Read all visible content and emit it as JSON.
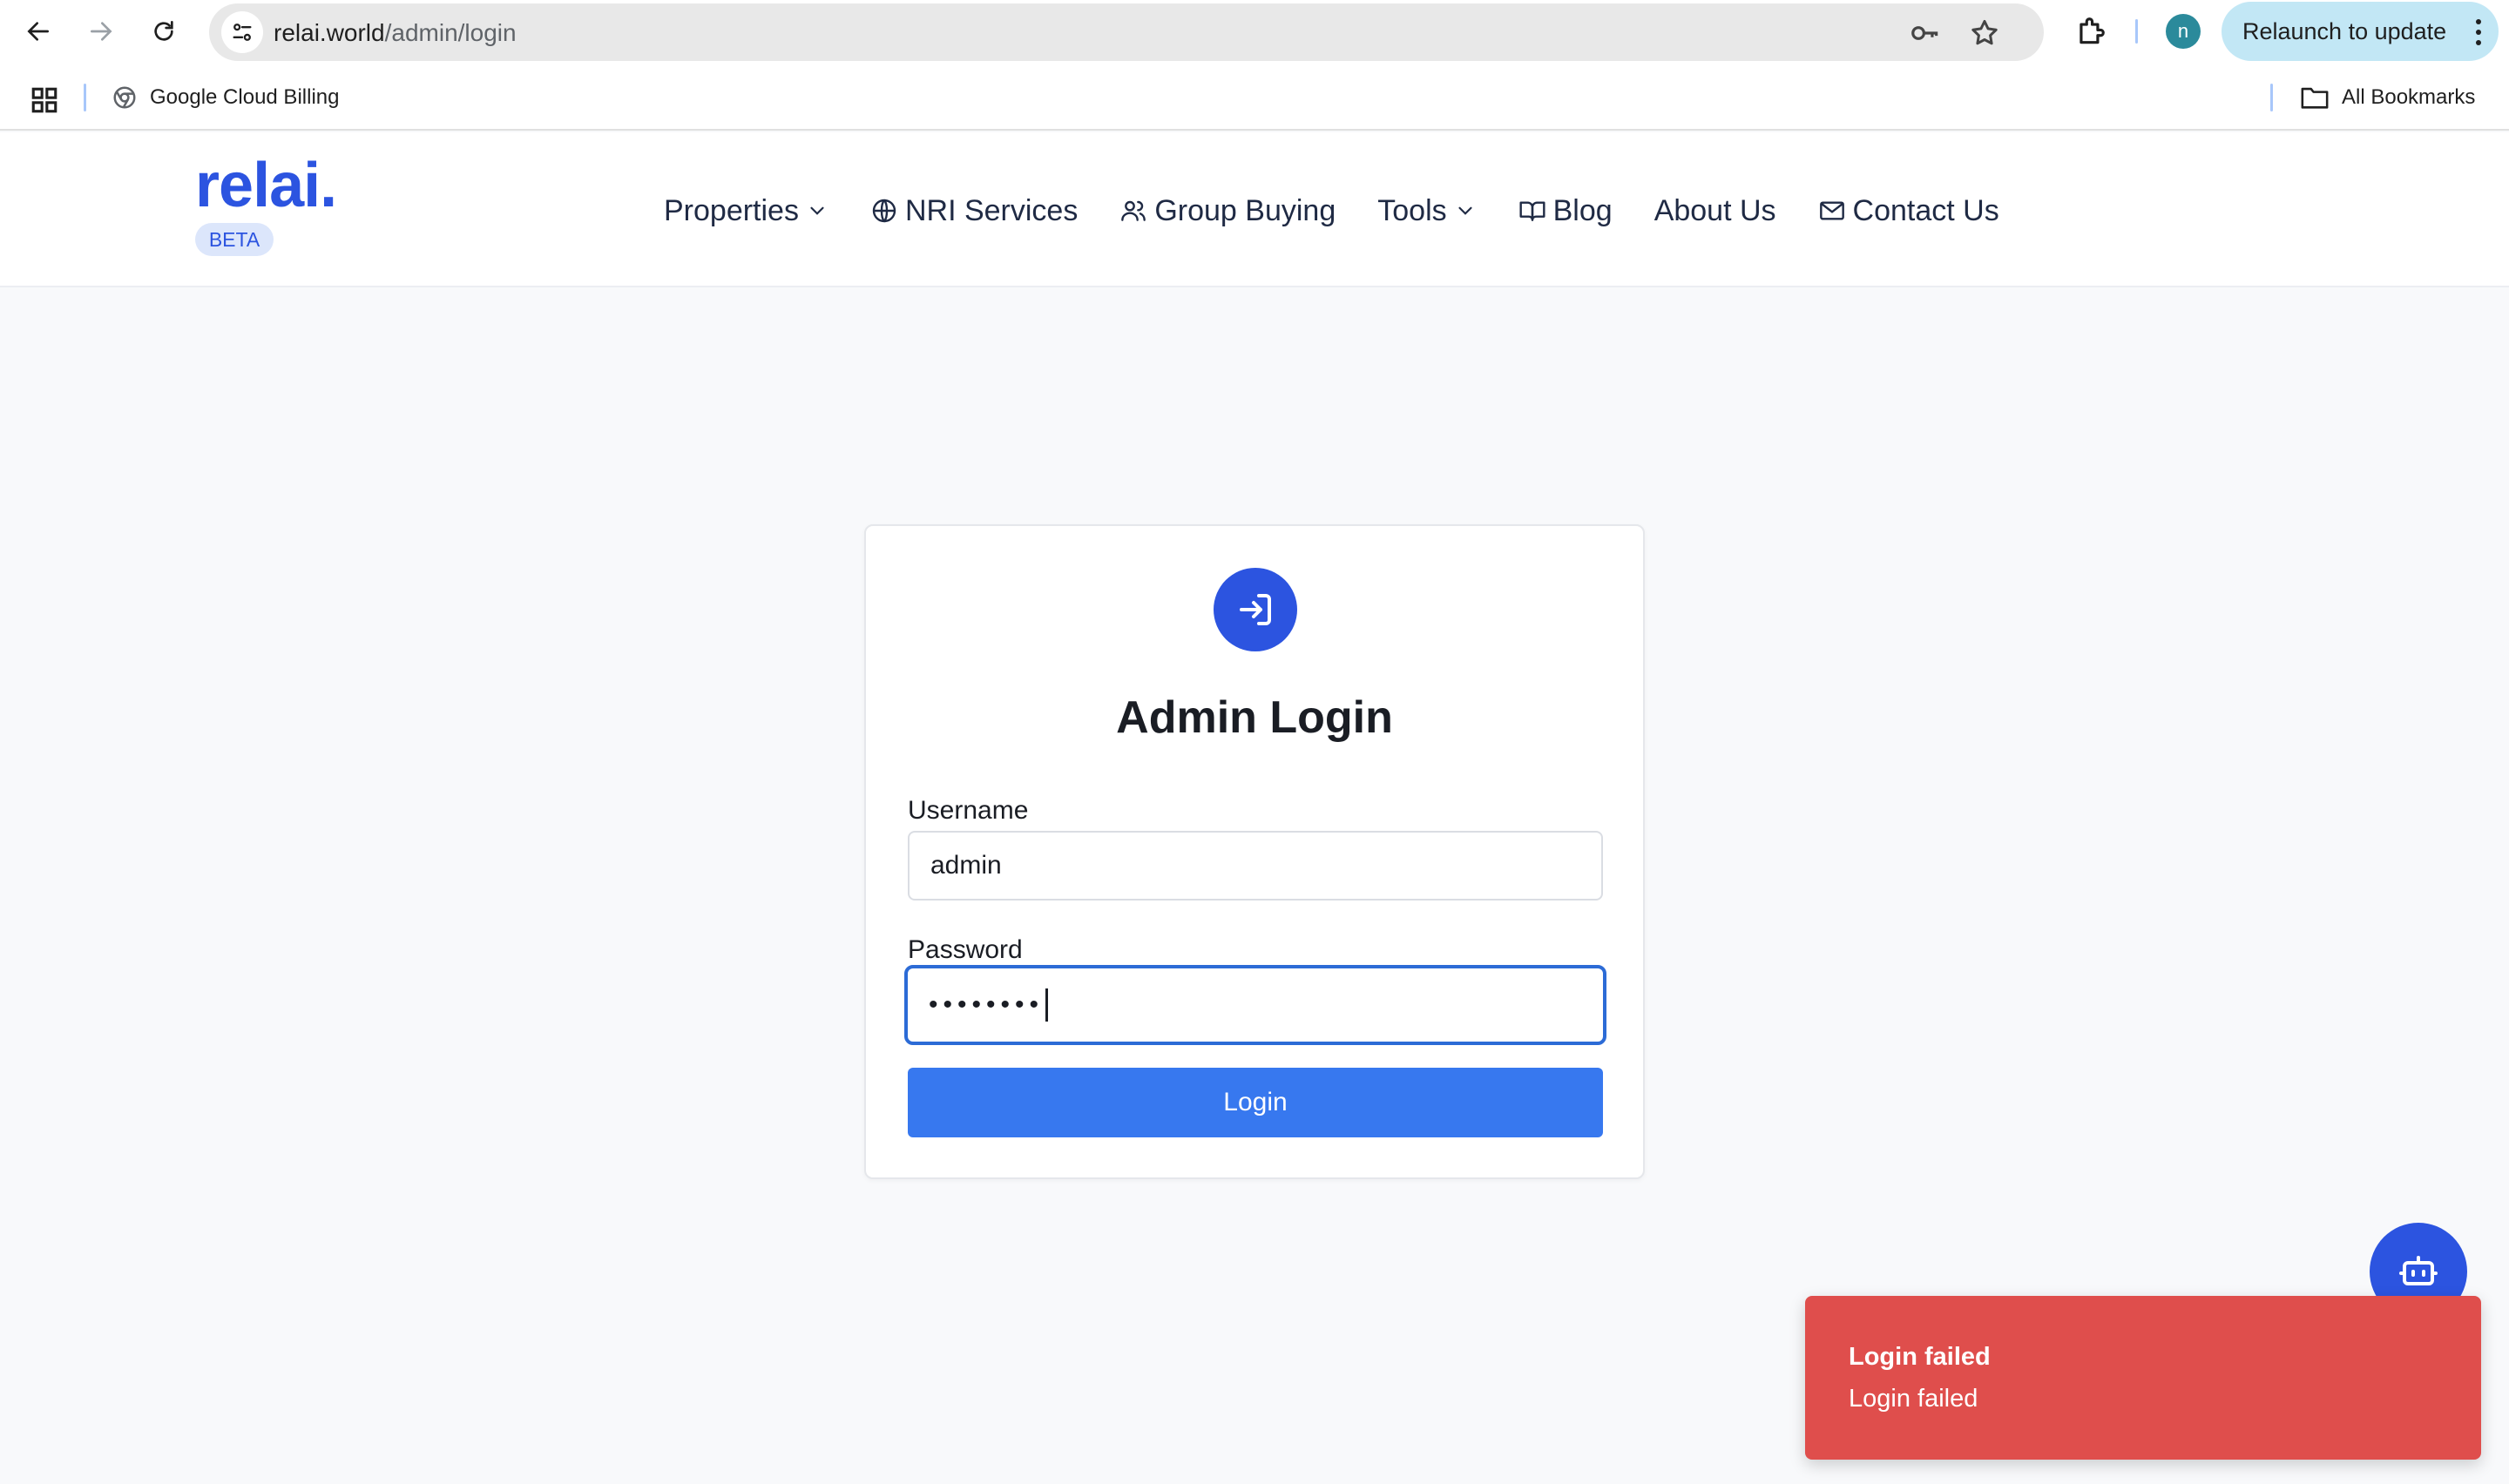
{
  "browser": {
    "url_host": "relai.world",
    "url_path": "/admin/login",
    "profile_initial": "n",
    "relaunch_label": "Relaunch to update",
    "bookmarks": {
      "items": [
        {
          "label": "Google Cloud Billing",
          "icon": "chrome-web-store-icon"
        }
      ],
      "all_bookmarks_label": "All Bookmarks"
    }
  },
  "site": {
    "logo": "relai.",
    "badge": "BETA",
    "nav": [
      {
        "label": "Properties",
        "icon": "chevron-down-icon"
      },
      {
        "label": "NRI Services",
        "icon": "globe-icon"
      },
      {
        "label": "Group Buying",
        "icon": "users-icon"
      },
      {
        "label": "Tools",
        "icon": "chevron-down-icon"
      },
      {
        "label": "Blog",
        "icon": "book-open-icon"
      },
      {
        "label": "About Us"
      },
      {
        "label": "Contact Us",
        "icon": "mail-icon"
      }
    ]
  },
  "login_card": {
    "title": "Admin Login",
    "username_label": "Username",
    "username_value": "admin",
    "password_label": "Password",
    "password_mask": "••••••••",
    "submit_label": "Login"
  },
  "toast": {
    "title": "Login failed",
    "message": "Login failed"
  },
  "colors": {
    "brand": "#2c54e0",
    "button": "#3778ef",
    "toast": "#df4e4c"
  }
}
